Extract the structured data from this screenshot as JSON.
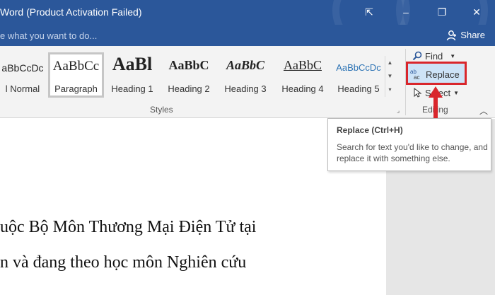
{
  "window": {
    "title": "Word (Product Activation Failed)",
    "tell_me": "e what you want to do...",
    "share_label": "Share",
    "controls": {
      "restore": "⇱",
      "minimize": "–",
      "maximize": "❐",
      "close": "✕"
    }
  },
  "styles": {
    "group_label": "Styles",
    "items": [
      {
        "sample": "aBbCcDc",
        "name": "l Normal"
      },
      {
        "sample": "AaBbCc",
        "name": "Paragraph"
      },
      {
        "sample": "AaBl",
        "name": "Heading 1"
      },
      {
        "sample": "AaBbC",
        "name": "Heading 2"
      },
      {
        "sample": "AaBbC",
        "name": "Heading 3"
      },
      {
        "sample": "AaBbC",
        "name": "Heading 4"
      },
      {
        "sample": "AaBbCcDc",
        "name": "Heading 5"
      }
    ]
  },
  "editing": {
    "group_label": "Editing",
    "find_label": "Find",
    "replace_label": "Replace",
    "select_label": "Select",
    "highlight_color": "#d9262c"
  },
  "tooltip": {
    "title": "Replace (Ctrl+H)",
    "description": "Search for text you'd like to change, and replace it with something else."
  },
  "document": {
    "line1": "uộc Bộ Môn Thương Mại Điện Tử tại",
    "line2": "n và đang theo học môn Nghiên cứu"
  },
  "colors": {
    "word_blue": "#2b579a",
    "ribbon_bg": "#f3f3f3"
  }
}
